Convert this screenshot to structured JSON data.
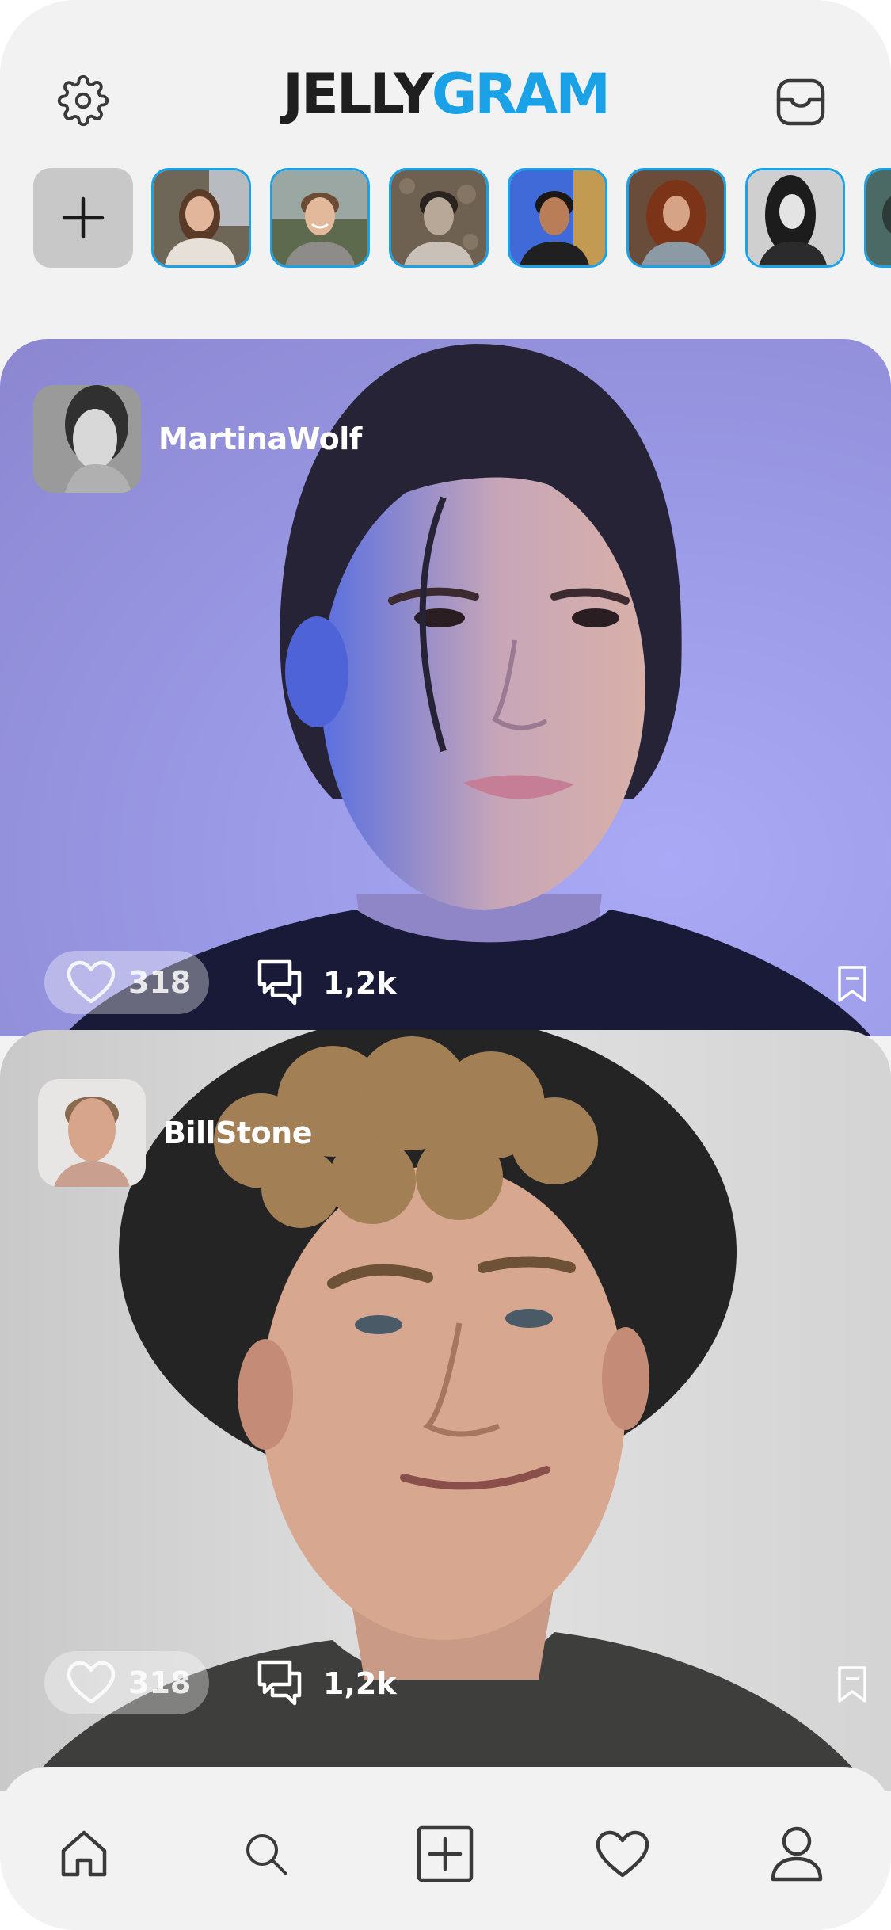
{
  "app": {
    "logo_part1": "JELLY",
    "logo_part2": "GRAM",
    "accent_color": "#1aa1e6"
  },
  "header": {
    "settings_icon": "gear-icon",
    "inbox_icon": "inbox-tray-icon"
  },
  "stories": {
    "add_icon": "plus-icon",
    "items": [
      {
        "name": "story-1"
      },
      {
        "name": "story-2"
      },
      {
        "name": "story-3"
      },
      {
        "name": "story-4"
      },
      {
        "name": "story-5"
      },
      {
        "name": "story-6"
      },
      {
        "name": "story-7"
      }
    ]
  },
  "posts": [
    {
      "author": "MartinaWolf",
      "likes": "318",
      "comments": "1,2k"
    },
    {
      "author": "BillStone",
      "likes": "318",
      "comments": "1,2k"
    }
  ],
  "nav": {
    "items": [
      "home-icon",
      "search-icon",
      "add-post-icon",
      "heart-icon",
      "profile-icon"
    ]
  }
}
